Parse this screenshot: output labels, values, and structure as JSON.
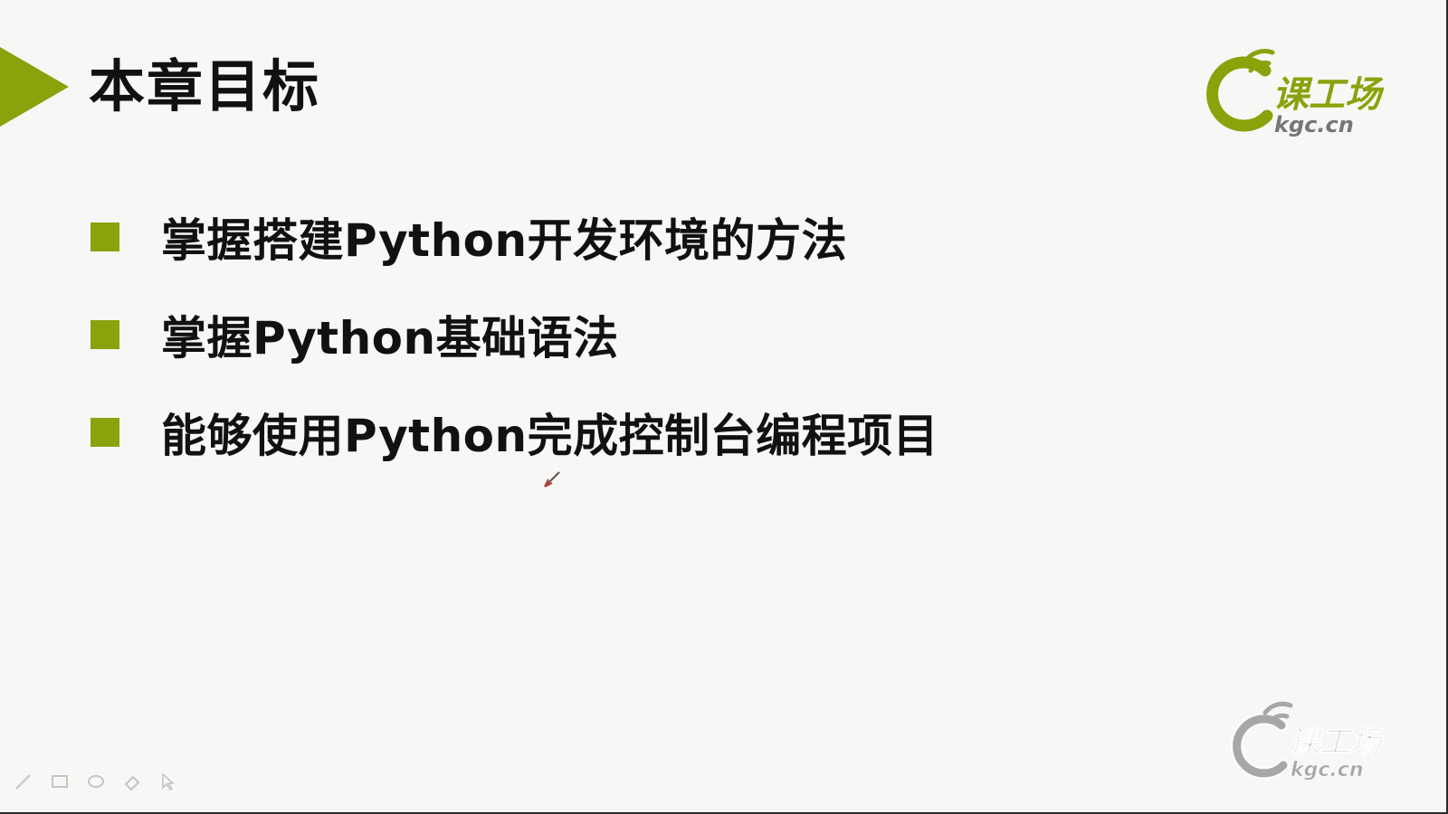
{
  "slide": {
    "title": "本章目标",
    "bullets": [
      "掌握搭建Python开发环境的方法",
      "掌握Python基础语法",
      "能够使用Python完成控制台编程项目"
    ]
  },
  "logo": {
    "brand": "课工场",
    "domain": "kgc.cn"
  },
  "watermark": {
    "brand": "课工场",
    "domain": "kgc.cn"
  },
  "toolbar": {
    "tools": [
      "pen-icon",
      "screen-icon",
      "ink-icon",
      "eraser-icon",
      "pointer-icon"
    ]
  },
  "colors": {
    "accent": "#8aa20c",
    "text": "#111111",
    "background": "#f8f7f5"
  }
}
